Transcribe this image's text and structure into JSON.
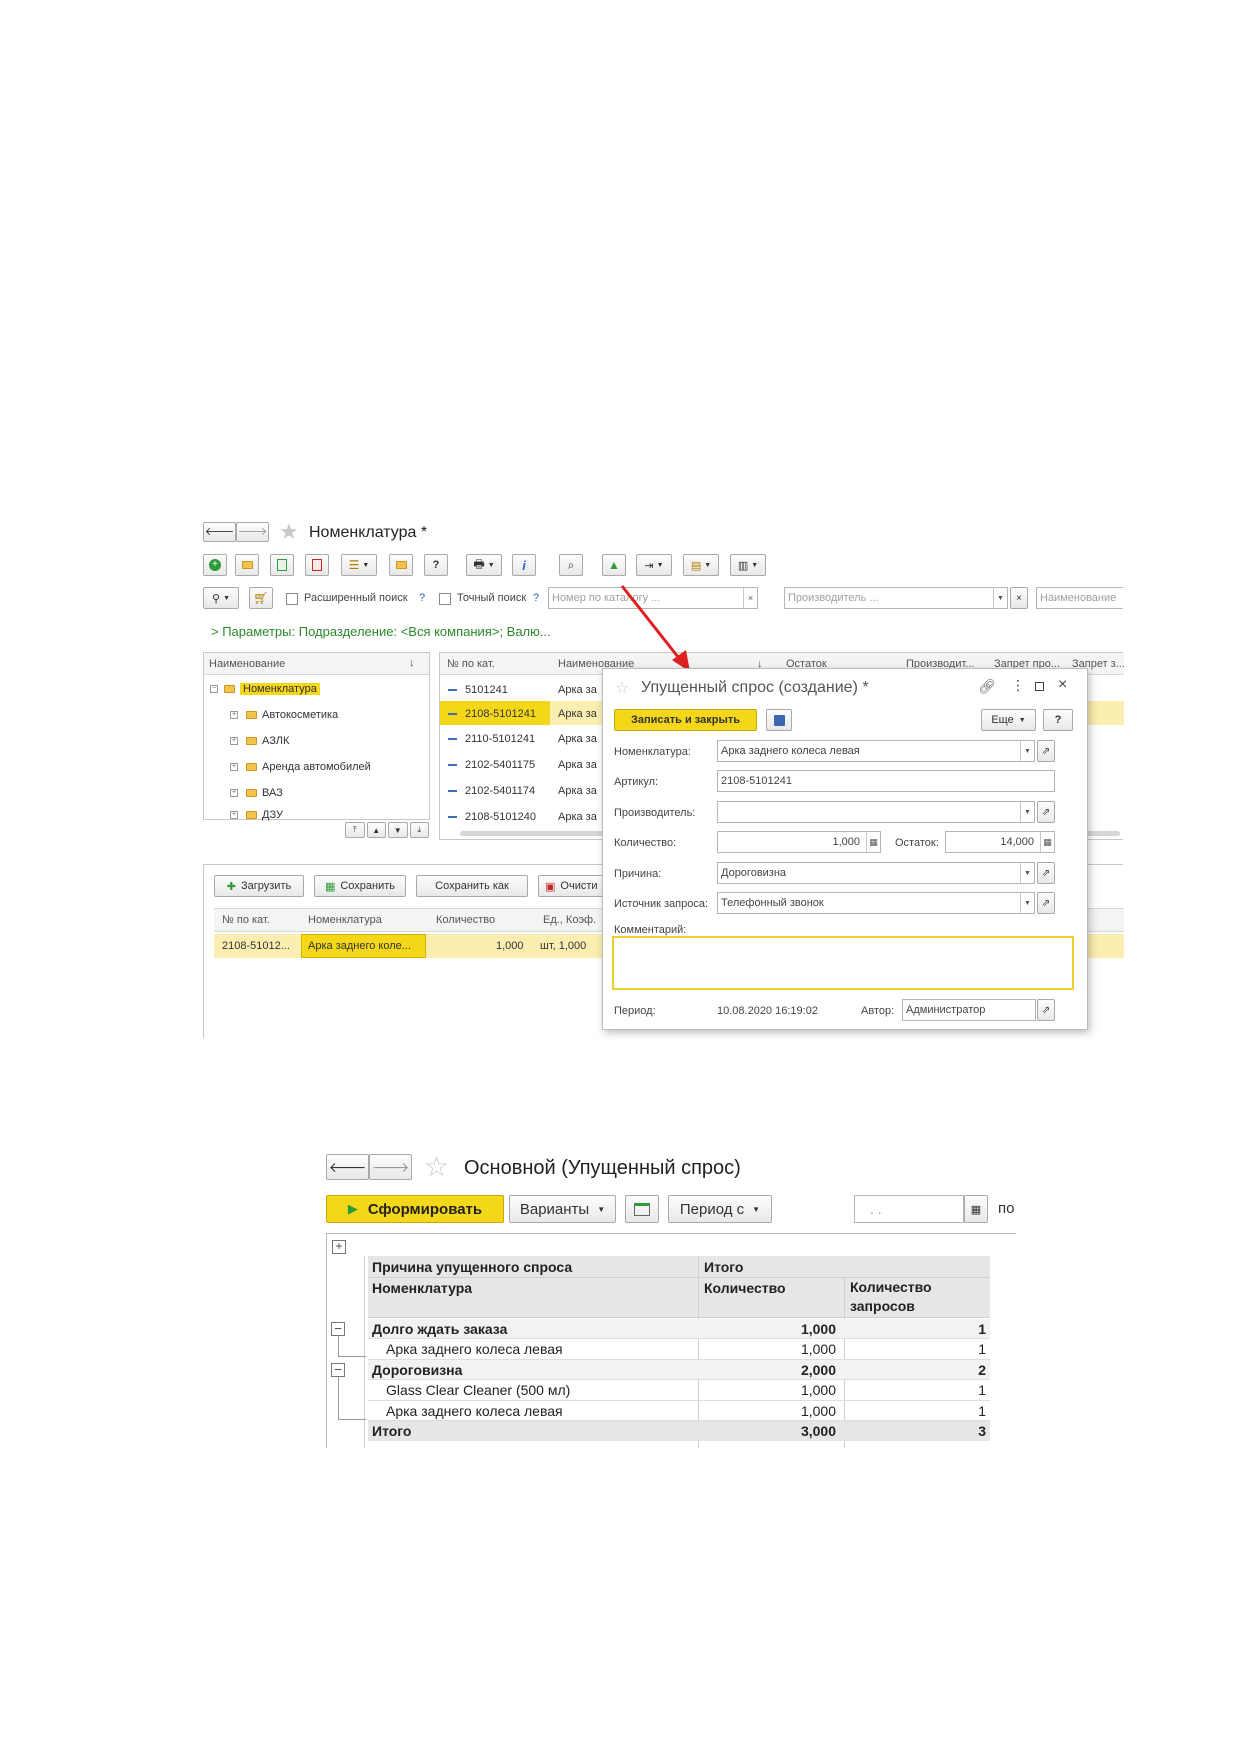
{
  "nomenclature_window": {
    "title": "Номенклатура *",
    "search_bar": {
      "extended_search_label": "Расширенный поиск",
      "exact_search_label": "Точный поиск",
      "help_mark": "?",
      "catalog_number_placeholder": "Номер по каталогу ...",
      "manufacturer_placeholder": "Производитель ...",
      "name_placeholder": "Наименование"
    },
    "parameters_line": "> Параметры: Подразделение: <Вся компания>; Валю...",
    "tree": {
      "header": "Наименование",
      "sort_mark": "↓",
      "root": "Номенклатура",
      "items": [
        "Автокосметика",
        "АЗЛК",
        "Аренда автомобилей",
        "ВАЗ",
        "ДЗУ"
      ]
    },
    "list": {
      "headers": [
        "№ по кат.",
        "Наименование",
        "↓",
        "Остаток",
        "Производит...",
        "Запрет про...",
        "Запрет з..."
      ],
      "rows": [
        {
          "number": "5101241",
          "name": "Арка за"
        },
        {
          "number": "2108-5101241",
          "name": "Арка за"
        },
        {
          "number": "2110-5101241",
          "name": "Арка за"
        },
        {
          "number": "2102-5401175",
          "name": "Арка за"
        },
        {
          "number": "2102-5401174",
          "name": "Арка за"
        },
        {
          "number": "2108-5101240",
          "name": "Арка за"
        }
      ]
    },
    "bottom_toolbar": {
      "load": "Загрузить",
      "save": "Сохранить",
      "save_as": "Сохранить как",
      "clear": "Очисти"
    },
    "bottom_table": {
      "headers": [
        "№ по кат.",
        "Номенклатура",
        "Количество",
        "Ед., Коэф."
      ],
      "row": {
        "number": "2108-51012...",
        "nomenclature": "Арка заднего коле...",
        "quantity": "1,000",
        "unit": "шт, 1,000"
      }
    }
  },
  "dialog": {
    "title": "Упущенный спрос (создание) *",
    "save_close_button": "Записать и закрыть",
    "more_button": "Еще",
    "help_button": "?",
    "fields": {
      "nomenclature_label": "Номенклатура:",
      "nomenclature_value": "Арка заднего колеса левая",
      "article_label": "Артикул:",
      "article_value": "2108-5101241",
      "manufacturer_label": "Производитель:",
      "manufacturer_value": "",
      "quantity_label": "Количество:",
      "quantity_value": "1,000",
      "stock_label": "Остаток:",
      "stock_value": "14,000",
      "reason_label": "Причина:",
      "reason_value": "Дороговизна",
      "source_label": "Источник запроса:",
      "source_value": "Телефонный звонок",
      "comment_label": "Комментарий:",
      "period_label": "Период:",
      "period_value": "10.08.2020 16:19:02",
      "author_label": "Автор:",
      "author_value": "Администратор"
    }
  },
  "report_window": {
    "title": "Основной (Упущенный спрос)",
    "generate_button": "Сформировать",
    "variants_button": "Варианты",
    "period_button": "Период с",
    "date_placeholder": ". .",
    "cut_label": "по",
    "table": {
      "header_row1": {
        "group": "Причина упущенного спроса",
        "total": "Итого"
      },
      "header_row2": {
        "name": "Номенклатура",
        "qty": "Количество",
        "requests": "Количество запросов"
      },
      "rows": [
        {
          "name": "Долго ждать заказа",
          "qty": "1,000",
          "req": "1",
          "level": 0
        },
        {
          "name": "Арка заднего колеса левая",
          "qty": "1,000",
          "req": "1",
          "level": 1
        },
        {
          "name": "Дороговизна",
          "qty": "2,000",
          "req": "2",
          "level": 0
        },
        {
          "name": "Glass Clear Cleaner (500 мл)",
          "qty": "1,000",
          "req": "1",
          "level": 1
        },
        {
          "name": "Арка заднего колеса левая",
          "qty": "1,000",
          "req": "1",
          "level": 1
        }
      ],
      "total": {
        "name": "Итого",
        "qty": "3,000",
        "req": "3"
      }
    }
  },
  "colors": {
    "yellow_accent": "#f5d71a",
    "highlight_row": "#fbeeb0",
    "green_link": "#2a8a2a",
    "arrow_red": "#e02020",
    "report_header_bg": "#e6e6e6"
  }
}
